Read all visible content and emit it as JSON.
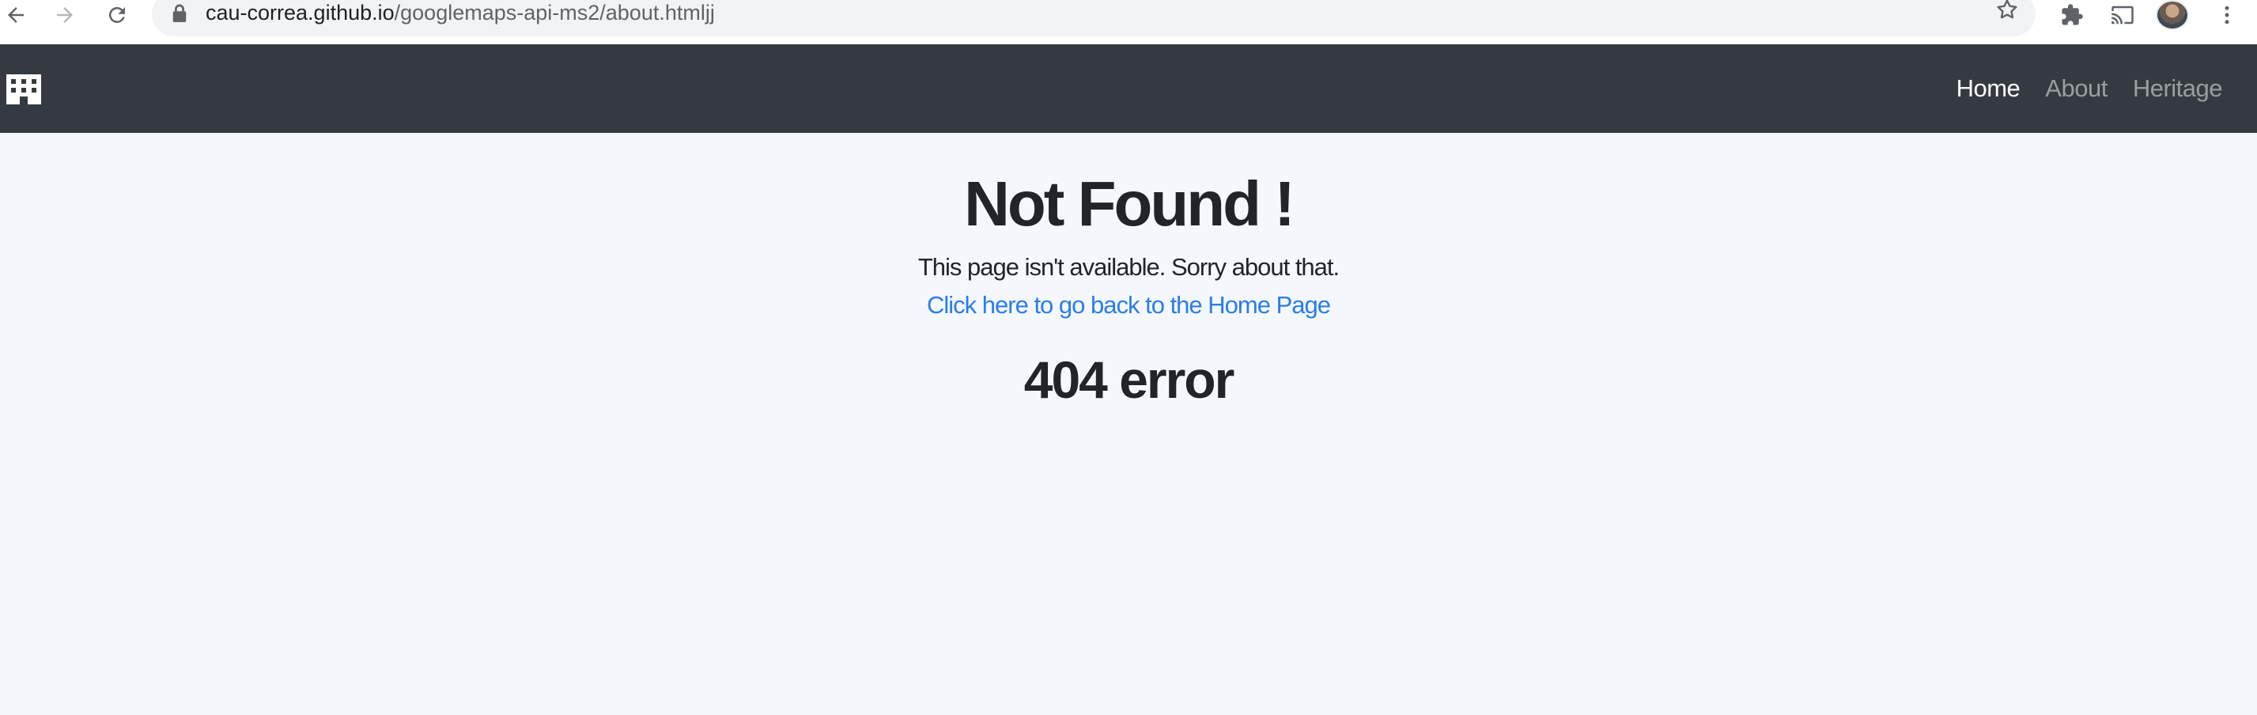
{
  "browser": {
    "url_host": "cau-correa.github.io",
    "url_path": "/googlemaps-api-ms2/about.htmljj"
  },
  "navbar": {
    "brand_icon": "building-icon",
    "links": [
      {
        "label": "Home",
        "active": true
      },
      {
        "label": "About",
        "active": false
      },
      {
        "label": "Heritage",
        "active": false
      }
    ]
  },
  "main": {
    "title": "Not Found !",
    "message": "This page isn't available. Sorry about that.",
    "home_link": "Click here to go back to the Home Page",
    "error_code": "404 error"
  },
  "colors": {
    "navbar_bg": "#343a40",
    "page_bg": "#f4f8fd",
    "link": "#2b7de9",
    "text": "#212529"
  }
}
